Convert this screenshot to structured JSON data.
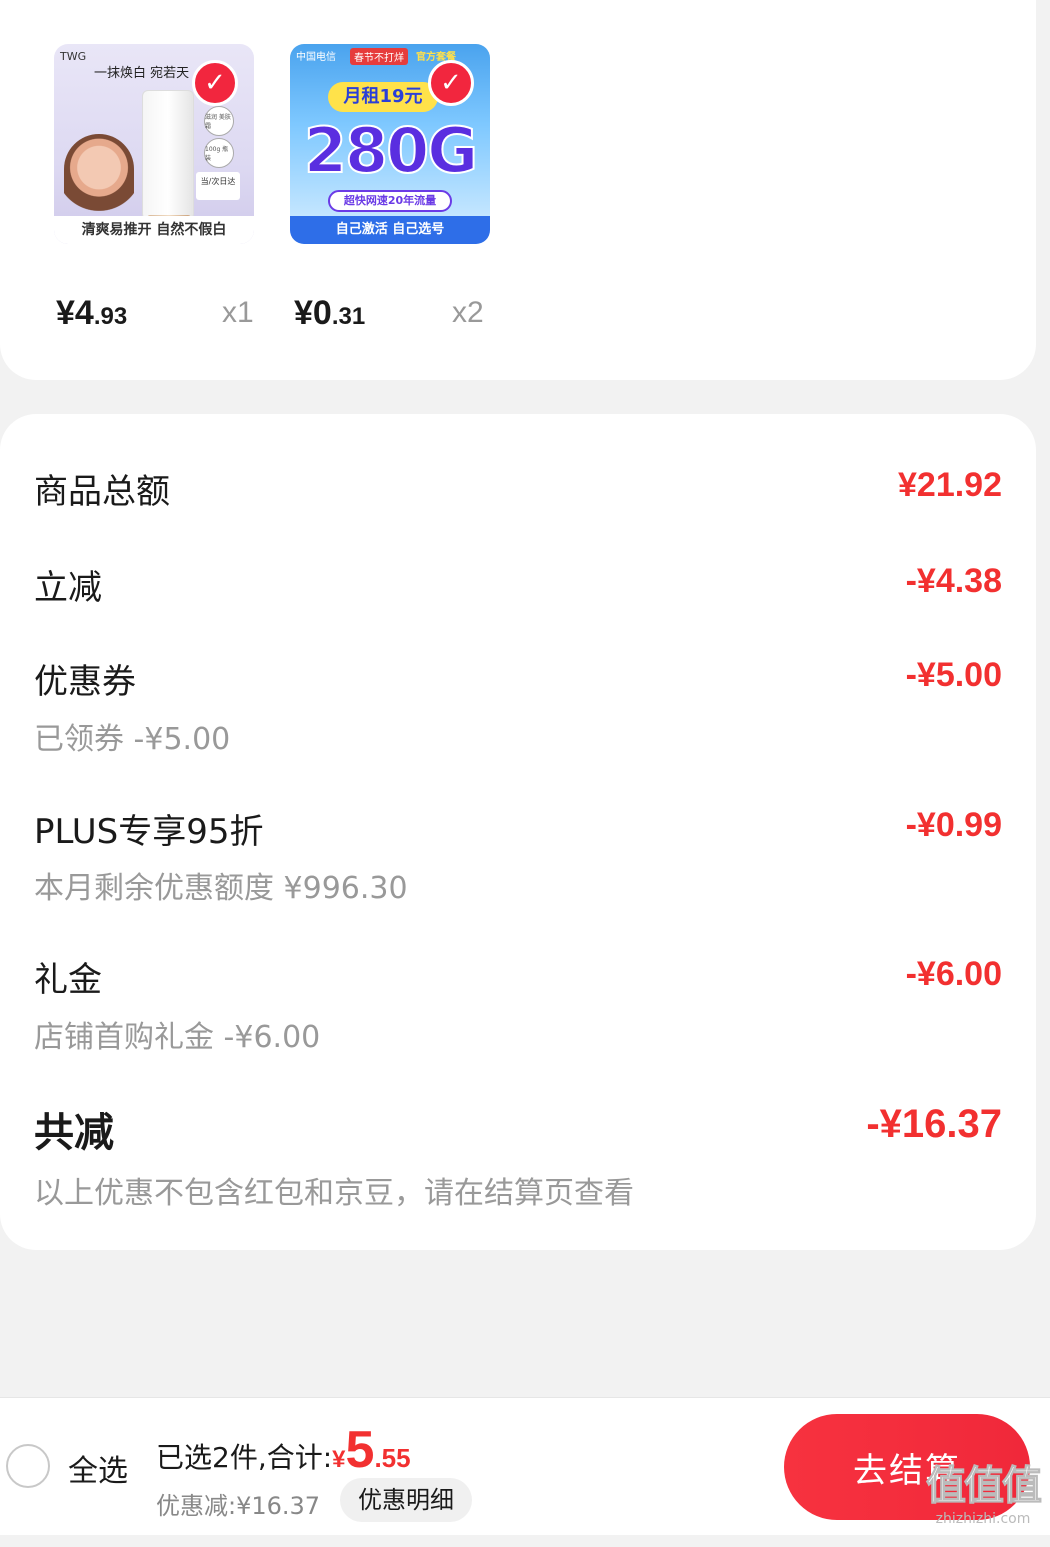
{
  "products": [
    {
      "price_int": "¥4",
      "price_dec": ".93",
      "qty": "x1",
      "selected": true,
      "art": {
        "brand": "TWG",
        "slogan": "一抹焕白 宛若天",
        "badge1": "滋润 美肤霜",
        "badge2": "100g 瓶装",
        "tag": "当/次日达",
        "bottom": "清爽易推开 自然不假白"
      }
    },
    {
      "price_int": "¥0",
      "price_dec": ".31",
      "qty": "x2",
      "selected": true,
      "art": {
        "carrier": "中国电信",
        "pill": "春节不打烊",
        "official": "官方套餐",
        "monthly": "月租19元",
        "big": "280G",
        "speed": "超快网速20年流量",
        "bottom": "自己激活 自己选号"
      }
    }
  ],
  "summary": {
    "goods_total_label": "商品总额",
    "goods_total_value": "¥21.92",
    "instant_label": "立减",
    "instant_value": "-¥4.38",
    "coupon_label": "优惠券",
    "coupon_sub": "已领券 -¥5.00",
    "coupon_value": "-¥5.00",
    "plus_label": "PLUS专享95折",
    "plus_sub": "本月剩余优惠额度 ¥996.30",
    "plus_value": "-¥0.99",
    "gift_label": "礼金",
    "gift_sub": "店铺首购礼金 -¥6.00",
    "gift_value": "-¥6.00",
    "total_label": "共减",
    "total_value": "-¥16.37",
    "note": "以上优惠不包含红包和京豆，请在结算页查看"
  },
  "bottom_bar": {
    "select_all": "全选",
    "selected_text": "已选2件,合计:",
    "yen": "¥",
    "total_int": "5",
    "total_dec": ".55",
    "discount_text": "优惠减:¥16.37",
    "detail_button": "优惠明细",
    "checkout_button": "去结算"
  },
  "watermark": {
    "logo": "值值值",
    "url": "zhizhizhi.com"
  },
  "colors": {
    "accent": "#f23030",
    "checkout": "#f7323f",
    "background": "#f2f2f2"
  }
}
